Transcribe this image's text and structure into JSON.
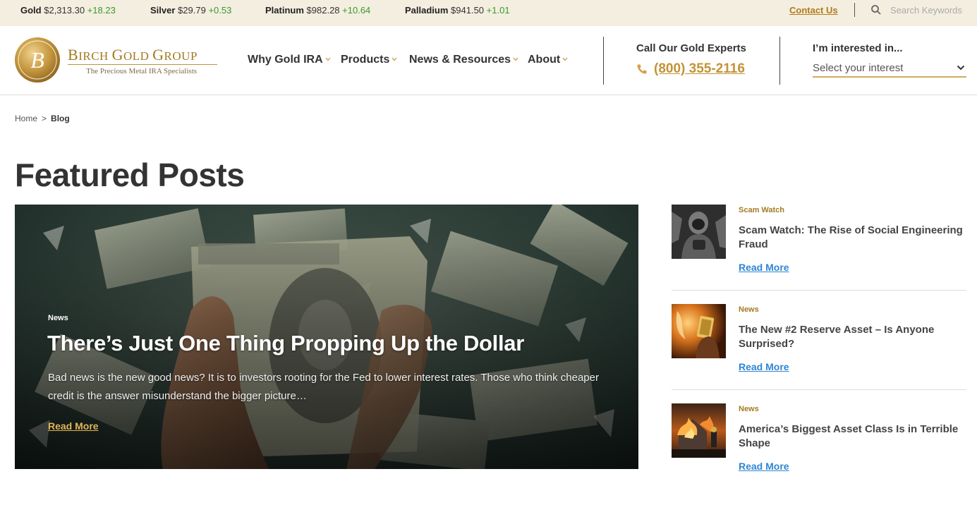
{
  "ticker": [
    {
      "metal": "Gold",
      "price": "$2,313.30",
      "change": "+18.23"
    },
    {
      "metal": "Silver",
      "price": "$29.79",
      "change": "+0.53"
    },
    {
      "metal": "Platinum",
      "price": "$982.28",
      "change": "+10.64"
    },
    {
      "metal": "Palladium",
      "price": "$941.50",
      "change": "+1.01"
    }
  ],
  "topbar": {
    "contact": "Contact Us",
    "search_placeholder": "Search Keywords"
  },
  "logo": {
    "name_first": "B",
    "name_rest1": "IRCH ",
    "name_g": "G",
    "name_rest2": "OLD ",
    "name_g2": "G",
    "name_rest3": "ROUP",
    "tagline": "The Precious Metal IRA Specialists"
  },
  "nav": [
    "Why Gold IRA",
    "Products",
    "News & Resources",
    "About"
  ],
  "call": {
    "label": "Call Our Gold Experts",
    "phone": "(800) 355-2116"
  },
  "interest": {
    "label": "I’m interested in...",
    "selected": "Select your interest"
  },
  "breadcrumb": {
    "home": "Home",
    "sep": ">",
    "current": "Blog"
  },
  "page_title": "Featured Posts",
  "hero": {
    "category": "News",
    "title": "There’s Just One Thing Propping Up the Dollar",
    "excerpt": "Bad news is the new good news? It is to investors rooting for the Fed to lower interest rates. Those who think cheaper credit is the answer misunderstand the bigger picture…",
    "read_more": "Read More"
  },
  "side_posts": [
    {
      "category": "Scam Watch",
      "title": "Scam Watch: The Rise of Social Engineering Fraud",
      "read_more": "Read More"
    },
    {
      "category": "News",
      "title": "The New #2 Reserve Asset – Is Anyone Surprised?",
      "read_more": "Read More"
    },
    {
      "category": "News",
      "title": "America’s Biggest Asset Class Is in Terrible Shape",
      "read_more": "Read More"
    }
  ],
  "colors": {
    "gold": "#a47a22",
    "link_blue": "#2f86d3",
    "ticker_bg": "#f3eee0",
    "up_green": "#3a9a2c"
  }
}
